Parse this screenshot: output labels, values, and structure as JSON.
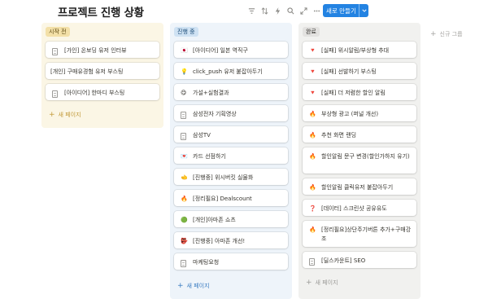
{
  "header": {
    "title": "프로젝트 진행 상황",
    "new_button_label": "새로 만들기",
    "new_button_dropdown": "⌄",
    "toolbar_icons": [
      "filter-icon",
      "sort-icon",
      "lightning-icon",
      "search-icon",
      "expand-icon",
      "more-icon"
    ]
  },
  "columns": [
    {
      "status": "시작 전",
      "color": "#fbf6e5",
      "cards": [
        {
          "icon": "doc",
          "title": "[가인] 온보딩 유저 인터뷰"
        },
        {
          "icon": "",
          "title": "[개인] 구매유경험 유저 부스팅"
        },
        {
          "icon": "doc",
          "title": "[아이디어] 한마디 부스팅"
        }
      ],
      "new_page": "새 페이지"
    },
    {
      "status": "진행 중",
      "color": "#eef4fa",
      "cards": [
        {
          "icon": "🇯🇵",
          "title": "[아이디어] 일본 역직구"
        },
        {
          "icon": "💡",
          "title": "click_push 유저 붙잡아두기"
        },
        {
          "icon": "😋",
          "title": "가설+실험결과"
        },
        {
          "icon": "doc",
          "title": "삼성전자 기획영상"
        },
        {
          "icon": "doc",
          "title": "삼성TV"
        },
        {
          "icon": "💌",
          "title": "카드 선점하기"
        },
        {
          "icon": "🫲",
          "title": "[진행중] 위시버킷 실물화"
        },
        {
          "icon": "🔥",
          "title": "[정리필요] Dealscount"
        },
        {
          "icon": "🟢",
          "title": "[개인]아마존 쇼츠"
        },
        {
          "icon": "👺",
          "title": "[진행중] 아마존 개선!"
        },
        {
          "icon": "doc",
          "title": "마케팅요청"
        }
      ],
      "new_page": "새 페이지"
    },
    {
      "status": "완료",
      "color": "#f1f1ef",
      "cards": [
        {
          "icon": "🔻",
          "title": "[실패] 위시알림/부상형 추대"
        },
        {
          "icon": "🔻",
          "title": "[실패] 선발하기 부스팅"
        },
        {
          "icon": "🔻",
          "title": "[실패] 더 저렴한 할인 알림"
        },
        {
          "icon": "🔥",
          "title": "부상형 광고 (퍼널 개선)"
        },
        {
          "icon": "🔥",
          "title": "추천 화면 랜딩"
        },
        {
          "icon": "🔥",
          "title": "할인알림 문구 변경(할인가하지 유기)"
        },
        {
          "icon": "🔥",
          "title": "할인알림 클릭유저 붙잡아두기"
        },
        {
          "icon": "❓",
          "title": "[데이터] 스크린샷 공유유도"
        },
        {
          "icon": "🔥",
          "title": "[정리필요]상단주기버튼 추가+구매강조"
        },
        {
          "icon": "doc",
          "title": "[딜스카운트] SEO"
        }
      ],
      "new_page": "새 페이지"
    }
  ],
  "hidden_group_label": "신규 그룹"
}
